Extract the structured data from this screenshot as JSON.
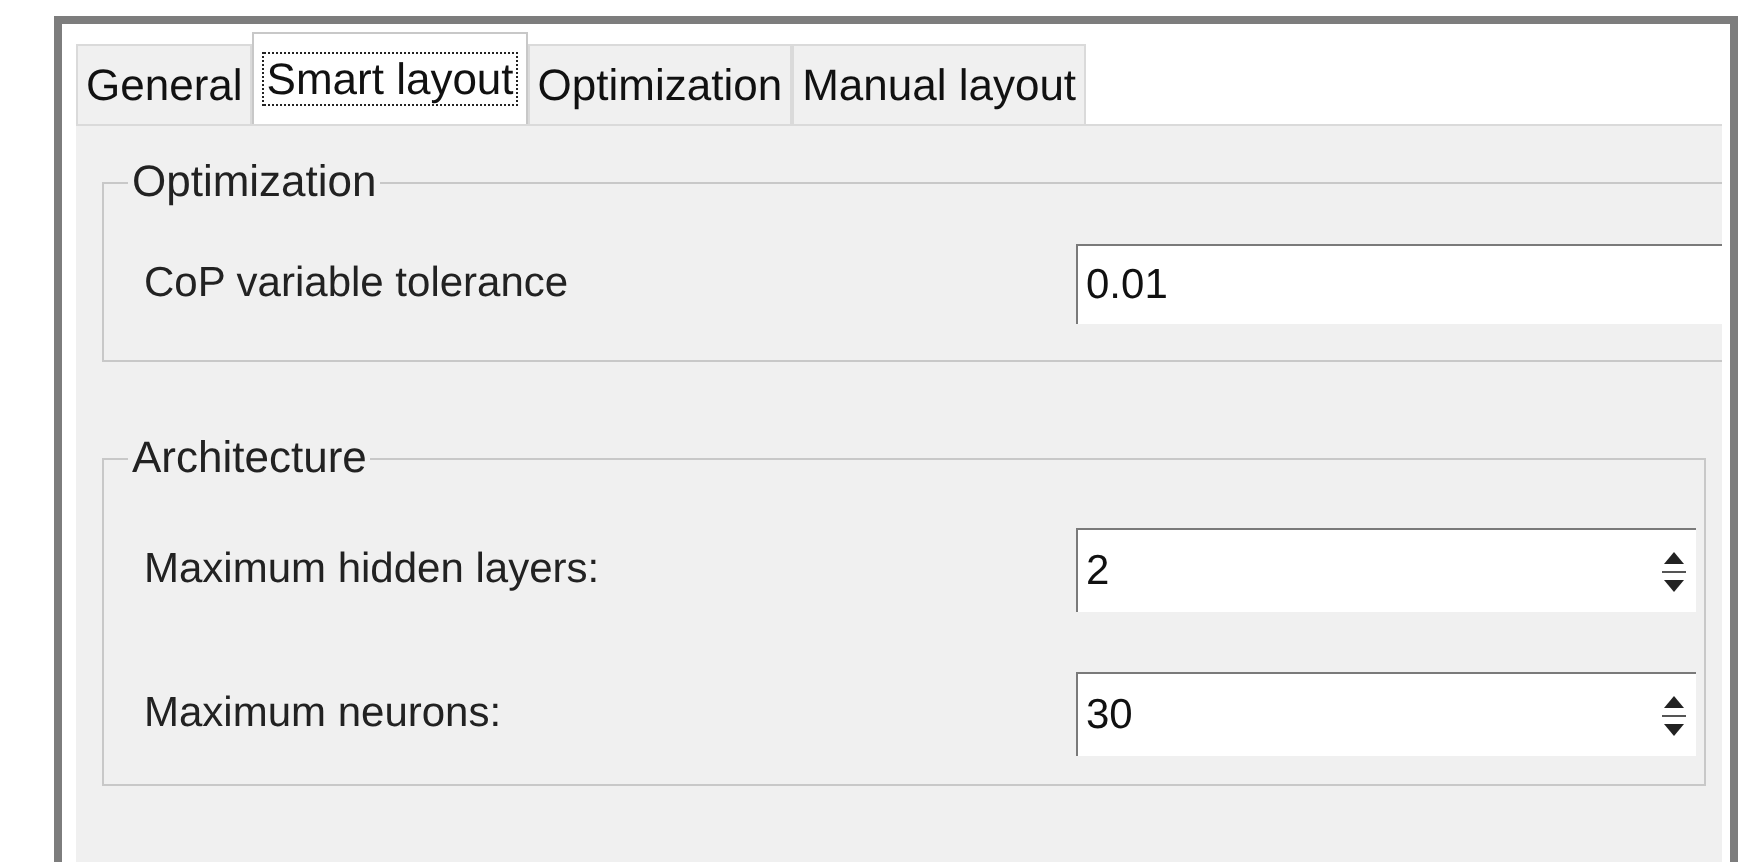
{
  "tabs": [
    {
      "label": "General",
      "selected": false
    },
    {
      "label": "Smart layout",
      "selected": true
    },
    {
      "label": "Optimization",
      "selected": false
    },
    {
      "label": "Manual layout",
      "selected": false
    }
  ],
  "groups": [
    {
      "title": "Optimization",
      "fields": [
        {
          "label": "CoP variable tolerance",
          "value": "0.01",
          "kind": "text"
        }
      ]
    },
    {
      "title": "Architecture",
      "fields": [
        {
          "label": "Maximum hidden layers:",
          "value": "2",
          "kind": "spin"
        },
        {
          "label": "Maximum neurons:",
          "value": "30",
          "kind": "spin"
        }
      ]
    }
  ]
}
